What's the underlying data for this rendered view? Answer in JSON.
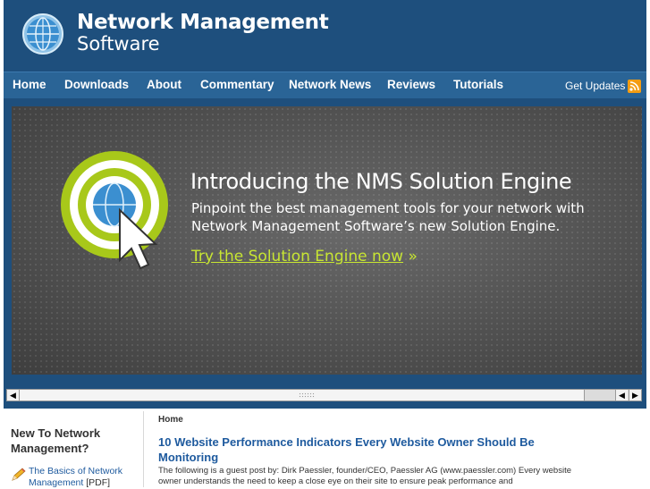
{
  "header": {
    "logo_line1": "Network Management",
    "logo_line2": "Software"
  },
  "nav": {
    "items": [
      "Home",
      "Downloads",
      "About",
      "Commentary",
      "Network News",
      "Reviews",
      "Tutorials"
    ],
    "get_updates": "Get Updates"
  },
  "banner": {
    "headline": "Introducing the NMS Solution Engine",
    "subline1": "Pinpoint the best management tools for your network with",
    "subline2": "Network Management Software’s new Solution Engine.",
    "cta_label": "Try the Solution Engine now",
    "cta_arrow": "»"
  },
  "sidebar": {
    "title": "New To Network Management?",
    "link_label": "The Basics of Network Management",
    "link_tag": "[PDF]"
  },
  "main": {
    "breadcrumb": "Home",
    "post_title": "10 Website Performance Indicators Every Website Owner Should Be Monitoring",
    "post_excerpt": "The following is a guest post by: Dirk Paessler, founder/CEO, Paessler AG (www.paessler.com) Every website owner understands the need to keep a close eye on their site to ensure peak performance and"
  },
  "colors": {
    "header_bg": "#1e4f7d",
    "nav_bg": "#2a6496",
    "accent_green": "#c8e632",
    "link_blue": "#1e5a9e",
    "rss_orange": "#f39c12"
  },
  "icons": [
    "globe-logo-icon",
    "rss-icon",
    "target-cursor-icon",
    "pencil-icon",
    "scroll-left-icon",
    "scroll-right-icon"
  ]
}
